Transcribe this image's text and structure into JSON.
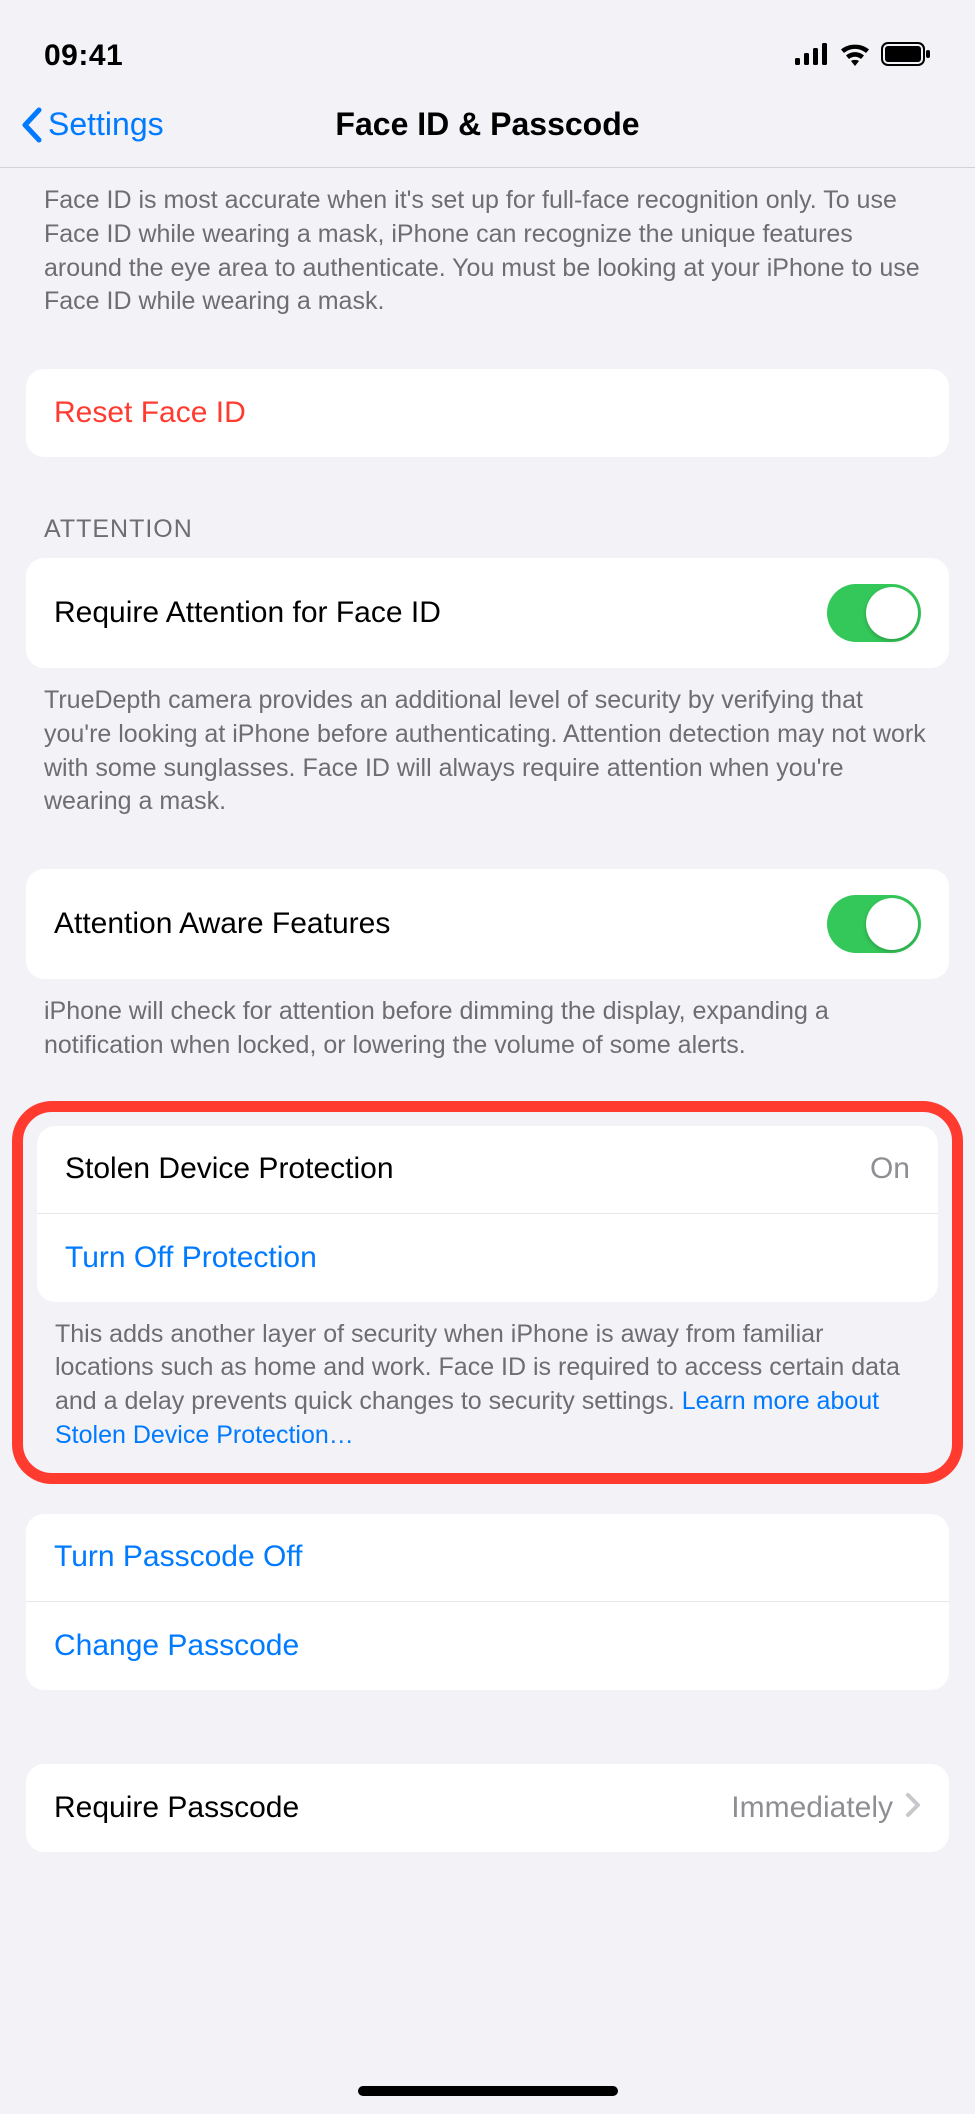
{
  "status": {
    "time": "09:41"
  },
  "nav": {
    "back_label": "Settings",
    "title": "Face ID & Passcode"
  },
  "faceid_footer": "Face ID is most accurate when it's set up for full-face recognition only. To use Face ID while wearing a mask, iPhone can recognize the unique features around the eye area to authenticate. You must be looking at your iPhone to use Face ID while wearing a mask.",
  "reset": {
    "label": "Reset Face ID"
  },
  "attention": {
    "header": "ATTENTION",
    "require_label": "Require Attention for Face ID",
    "require_toggle": true,
    "require_footer": "TrueDepth camera provides an additional level of security by verifying that you're looking at iPhone before authenticating. Attention detection may not work with some sunglasses. Face ID will always require attention when you're wearing a mask.",
    "aware_label": "Attention Aware Features",
    "aware_toggle": true,
    "aware_footer": "iPhone will check for attention before dimming the display, expanding a notification when locked, or lowering the volume of some alerts."
  },
  "stolen": {
    "label": "Stolen Device Protection",
    "value": "On",
    "turn_off_label": "Turn Off Protection",
    "footer_text": "This adds another layer of security when iPhone is away from familiar locations such as home and work. Face ID is required to access certain data and a delay prevents quick changes to security settings. ",
    "learn_more": "Learn more about Stolen Device Protection…"
  },
  "passcode": {
    "turn_off_label": "Turn Passcode Off",
    "change_label": "Change Passcode",
    "require_label": "Require Passcode",
    "require_value": "Immediately"
  }
}
